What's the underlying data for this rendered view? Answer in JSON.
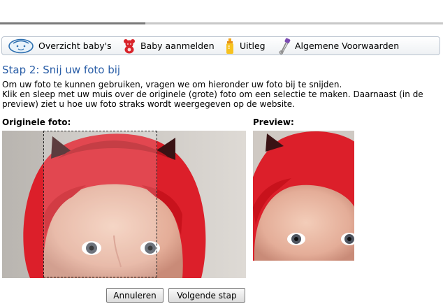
{
  "nav": {
    "items": [
      {
        "label": "Overzicht baby's",
        "icon": "baby-face-icon"
      },
      {
        "label": "Baby aanmelden",
        "icon": "teddy-bear-icon"
      },
      {
        "label": "Uitleg",
        "icon": "baby-bottle-icon"
      },
      {
        "label": "Algemene Voorwaarden",
        "icon": "safety-pin-icon"
      }
    ]
  },
  "page": {
    "title": "Stap 2: Snij uw foto bij",
    "intro": [
      "Om uw foto te kunnen gebruiken, vragen we om hieronder uw foto bij te snijden.",
      "Klik en sleep met uw muis over de originele (grote) foto om een selectie te maken. Daarnaast (in de",
      "preview) ziet u hoe uw foto straks wordt weergegeven op de website."
    ],
    "original_label": "Originele foto:",
    "preview_label": "Preview:"
  },
  "buttons": {
    "cancel": "Annuleren",
    "next": "Volgende stap"
  },
  "colors": {
    "title": "#2a5ea7",
    "hood": "#e0222b",
    "background": "#d5d0cb"
  }
}
